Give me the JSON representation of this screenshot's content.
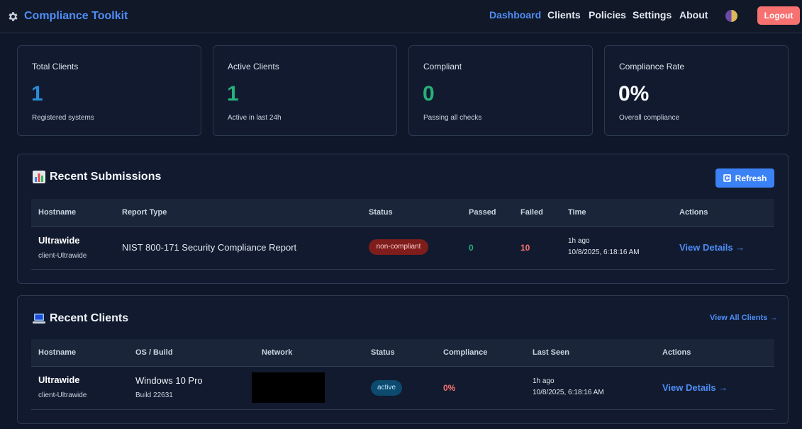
{
  "app": {
    "title": "Compliance Toolkit",
    "icon": "gear-icon"
  },
  "nav": {
    "items": [
      {
        "label": "Dashboard",
        "active": true
      },
      {
        "label": "Clients",
        "active": false
      },
      {
        "label": "Policies",
        "active": false
      },
      {
        "label": "Settings",
        "active": false
      },
      {
        "label": "About",
        "active": false
      }
    ],
    "theme_toggle_icon": "theme-toggle-icon",
    "logout_label": "Logout"
  },
  "stats": [
    {
      "label": "Total Clients",
      "value": "1",
      "sub": "Registered systems",
      "color": "#2b8ad6"
    },
    {
      "label": "Active Clients",
      "value": "1",
      "sub": "Active in last 24h",
      "color": "#27b07a"
    },
    {
      "label": "Compliant",
      "value": "0",
      "sub": "Passing all checks",
      "color": "#27b07a"
    },
    {
      "label": "Compliance Rate",
      "value": "0%",
      "sub": "Overall compliance",
      "color": "#f8fafc"
    }
  ],
  "submissions": {
    "title": "Recent Submissions",
    "icon": "bar-chart-icon",
    "refresh_label": "Refresh",
    "refresh_icon": "refresh-icon",
    "columns": [
      "Hostname",
      "Report Type",
      "Status",
      "Passed",
      "Failed",
      "Time",
      "Actions"
    ],
    "rows": [
      {
        "hostname": "Ultrawide",
        "client_id": "client-Ultrawide",
        "report_type": "NIST 800-171 Security Compliance Report",
        "status": "non-compliant",
        "passed": "0",
        "failed": "10",
        "time_relative": "1h ago",
        "time_absolute": "10/8/2025, 6:18:16 AM",
        "action": "View Details →"
      }
    ]
  },
  "clients": {
    "title": "Recent Clients",
    "icon": "laptop-icon",
    "view_all_label": "View All Clients →",
    "columns": [
      "Hostname",
      "OS / Build",
      "Network",
      "Status",
      "Compliance",
      "Last Seen",
      "Actions"
    ],
    "rows": [
      {
        "hostname": "Ultrawide",
        "client_id": "client-Ultrawide",
        "os": "Windows 10 Pro",
        "build": "Build 22631",
        "status": "active",
        "compliance": "0%",
        "last_seen_relative": "1h ago",
        "last_seen_absolute": "10/8/2025, 6:18:16 AM",
        "action": "View Details →"
      }
    ]
  },
  "colors": {
    "accent": "#4f8ef7",
    "background": "#0f172a",
    "danger": "#f87171",
    "success": "#27b07a"
  }
}
